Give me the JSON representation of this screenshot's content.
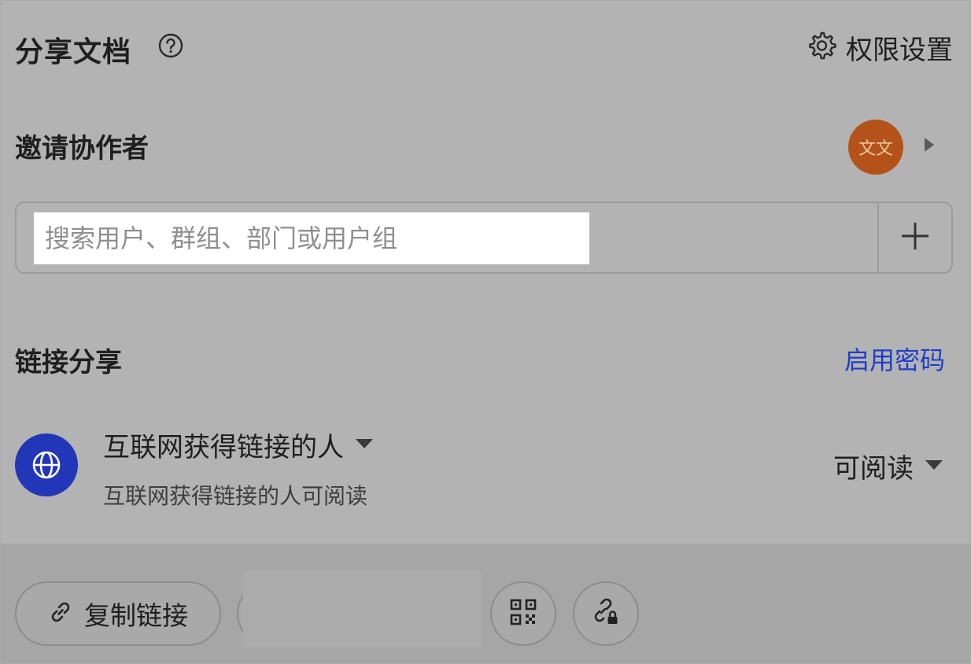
{
  "header": {
    "title": "分享文档",
    "permission_settings_label": "权限设置"
  },
  "invite": {
    "title": "邀请协作者",
    "avatar_text": "文文",
    "search_placeholder": "搜索用户、群组、部门或用户组"
  },
  "link_share": {
    "title": "链接分享",
    "enable_password_label": "启用密码",
    "scope_label": "互联网获得链接的人",
    "scope_description": "互联网获得链接的人可阅读",
    "permission_label": "可阅读"
  },
  "footer": {
    "copy_link_label": "复制链接"
  },
  "icons": {
    "help": "help-icon",
    "settings": "gear-icon",
    "avatar_more": "caret-right-icon",
    "add": "plus-icon",
    "globe": "globe-icon",
    "dropdown": "caret-down-icon",
    "link": "link-icon",
    "qr": "qr-code-icon",
    "link_lock": "link-lock-icon"
  },
  "colors": {
    "accent_link": "#1e3fc8",
    "globe_bg": "#2236b8",
    "avatar_bg": "#b4521a"
  }
}
